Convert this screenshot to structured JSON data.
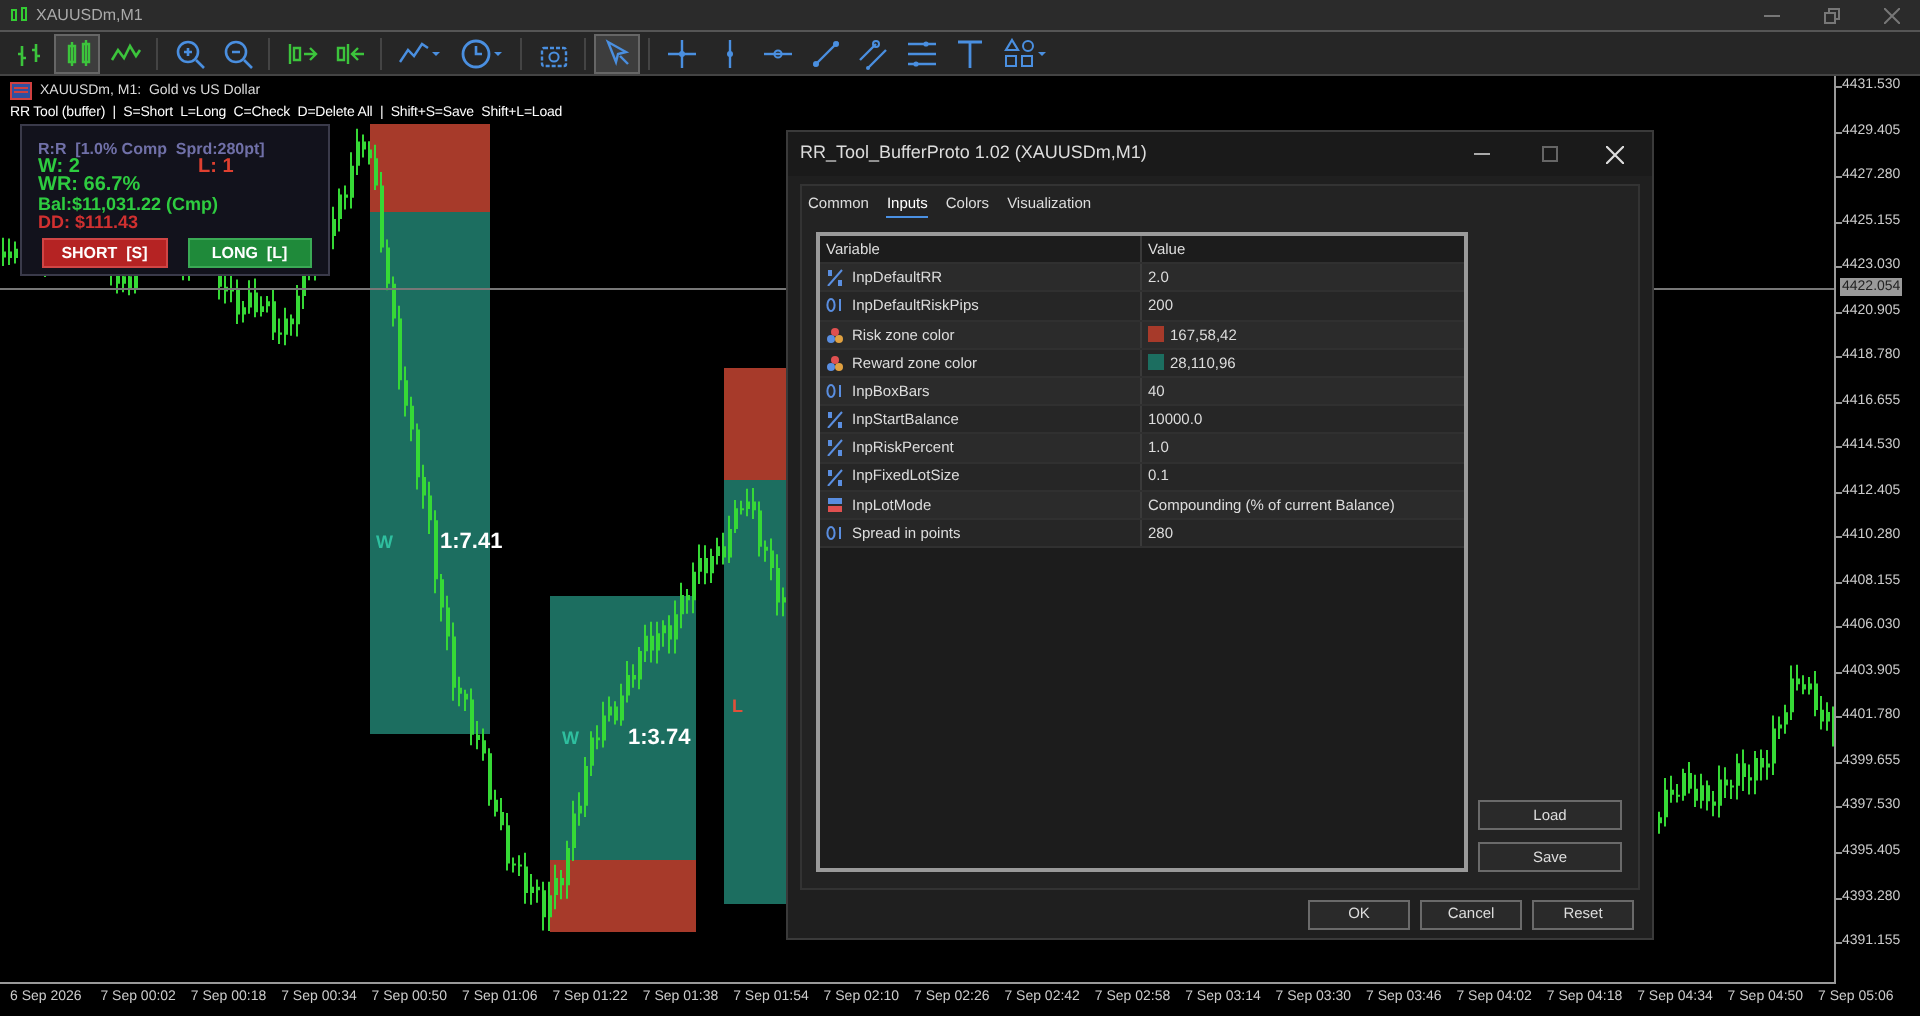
{
  "window": {
    "title": "XAUUSDm,M1"
  },
  "toolbar": [
    {
      "kind": "bars",
      "selected": false
    },
    {
      "kind": "candles",
      "selected": true
    },
    {
      "kind": "line",
      "selected": false
    },
    {
      "kind": "zoom-in",
      "selected": false
    },
    {
      "kind": "zoom-out",
      "selected": false
    },
    {
      "kind": "autoscroll",
      "selected": false
    },
    {
      "kind": "shift",
      "selected": false
    },
    {
      "kind": "indicators",
      "selected": false
    },
    {
      "kind": "clock",
      "selected": false
    },
    {
      "kind": "screenshot",
      "selected": false
    },
    {
      "kind": "cursor",
      "selected": true
    },
    {
      "kind": "crosshair",
      "selected": false
    },
    {
      "kind": "vline",
      "selected": false
    },
    {
      "kind": "hline",
      "selected": false
    },
    {
      "kind": "trendline",
      "selected": false
    },
    {
      "kind": "channel",
      "selected": false
    },
    {
      "kind": "fibo",
      "selected": false
    },
    {
      "kind": "text",
      "selected": false
    },
    {
      "kind": "shapes",
      "selected": false
    }
  ],
  "chart": {
    "title": "XAUUSDm, M1:  Gold vs US Dollar",
    "hint": "RR Tool (buffer)  |  S=Short  L=Long  C=Check  D=Delete All  |  Shift+S=Save  Shift+L=Load",
    "panel": {
      "header": "R:R  [1.0% Comp  Sprd:280pt]",
      "wins": "W: 2",
      "losses": "L: 1",
      "win_rate": "WR: 66.7%",
      "balance": "Bal:$11,031.22 (Cmp)",
      "drawdown": "DD: $111.43",
      "buttons": [
        {
          "kind": "short",
          "label": "SHORT  [S]"
        },
        {
          "kind": "long",
          "label": "LONG  [L]"
        }
      ]
    },
    "rr_boxes": [
      {
        "result": "W",
        "ratio": "1:7.41"
      },
      {
        "result": "W",
        "ratio": "1:3.74"
      },
      {
        "result": "L"
      }
    ]
  },
  "price_axis": {
    "labels": [
      "4431.530",
      "4429.405",
      "4427.280",
      "4425.155",
      "4423.030",
      "4420.905",
      "4418.780",
      "4416.655",
      "4414.530",
      "4412.405",
      "4410.280",
      "4408.155",
      "4406.030",
      "4403.905",
      "4401.780",
      "4399.655",
      "4397.530",
      "4395.405",
      "4393.280",
      "4391.155"
    ],
    "current": "4422.054"
  },
  "time_axis": [
    "6 Sep 2026",
    "7 Sep 00:02",
    "7 Sep 00:18",
    "7 Sep 00:34",
    "7 Sep 00:50",
    "7 Sep 01:06",
    "7 Sep 01:22",
    "7 Sep 01:38",
    "7 Sep 01:54",
    "7 Sep 02:10",
    "7 Sep 02:26",
    "7 Sep 02:42",
    "7 Sep 02:58",
    "7 Sep 03:14",
    "7 Sep 03:30",
    "7 Sep 03:46",
    "7 Sep 04:02",
    "7 Sep 04:18",
    "7 Sep 04:34",
    "7 Sep 04:50",
    "7 Sep 05:06"
  ],
  "dialog": {
    "title": "RR_Tool_BufferProto 1.02 (XAUUSDm,M1)",
    "tabs": [
      {
        "label": "Common",
        "selected": false
      },
      {
        "label": "Inputs",
        "selected": true
      },
      {
        "label": "Colors",
        "selected": false
      },
      {
        "label": "Visualization",
        "selected": false
      }
    ],
    "columns": [
      "Variable",
      "Value"
    ],
    "rows": [
      {
        "kind": "double",
        "variable": "InpDefaultRR",
        "value": "2.0"
      },
      {
        "kind": "int",
        "variable": "InpDefaultRiskPips",
        "value": "200"
      },
      {
        "kind": "color",
        "variable": "Risk zone color",
        "value": "167,58,42",
        "color": "#a73a2a"
      },
      {
        "kind": "color",
        "variable": "Reward zone color",
        "value": "28,110,96",
        "color": "#1c6e60"
      },
      {
        "kind": "int",
        "variable": "InpBoxBars",
        "value": "40"
      },
      {
        "kind": "double",
        "variable": "InpStartBalance",
        "value": "10000.0"
      },
      {
        "kind": "double",
        "variable": "InpRiskPercent",
        "value": "1.0"
      },
      {
        "kind": "double",
        "variable": "InpFixedLotSize",
        "value": "0.1"
      },
      {
        "kind": "enum",
        "variable": "InpLotMode",
        "value": "Compounding (% of current Balance)"
      },
      {
        "kind": "int",
        "variable": "Spread in points",
        "value": "280"
      }
    ],
    "side_buttons": [
      "Load",
      "Save"
    ],
    "buttons": [
      "OK",
      "Cancel",
      "Reset"
    ]
  }
}
